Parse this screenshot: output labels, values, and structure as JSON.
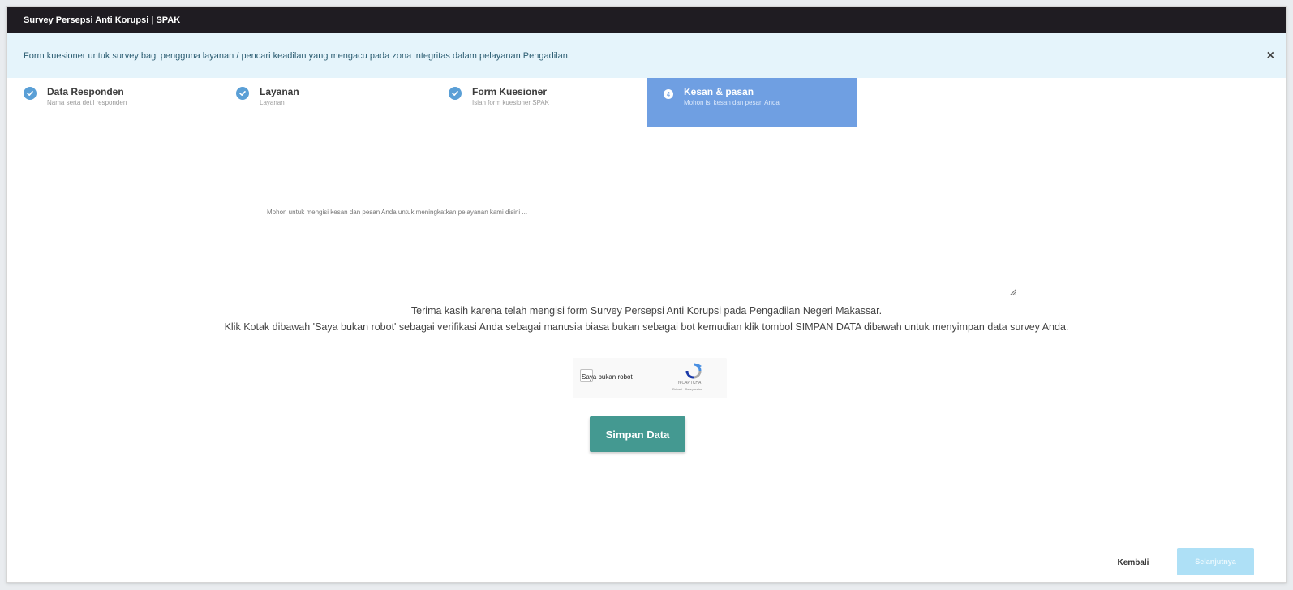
{
  "window": {
    "title": "Survey Persepsi Anti Korupsi | SPAK"
  },
  "info": {
    "text": "Form kuesioner untuk survey bagi pengguna layanan / pencari keadilan yang mengacu pada zona integritas dalam pelayanan Pengadilan.",
    "close_symbol": "×"
  },
  "steps": [
    {
      "label": "Data Responden",
      "sub": "Nama serta detil responden",
      "status": "complete",
      "icon": "check-circle-icon"
    },
    {
      "label": "Layanan",
      "sub": "Layanan",
      "status": "complete",
      "icon": "check-circle-icon"
    },
    {
      "label": "Form Kuesioner",
      "sub": "Isian form kuesioner SPAK",
      "status": "complete",
      "icon": "check-circle-icon"
    },
    {
      "number": "4",
      "label": "Kesan & pasan",
      "sub": "Mohon isi kesan dan pesan Anda",
      "status": "active"
    }
  ],
  "form": {
    "textarea_placeholder": "Mohon untuk mengisi kesan dan pesan Anda untuk meningkatkan pelayanan kami disini ...",
    "thanks_line1": "Terima kasih karena telah mengisi form Survey Persepsi Anti Korupsi pada Pengadilan Negeri Makassar.",
    "thanks_line2": "Klik Kotak dibawah 'Saya bukan robot' sebagai verifikasi Anda sebagai manusia biasa bukan sebagai bot kemudian klik tombol SIMPAN DATA dibawah untuk menyimpan data survey Anda."
  },
  "captcha": {
    "label": "Saya bukan robot",
    "brand": "reCAPTCHA",
    "terms": "Privasi - Persyaratan",
    "checked": false
  },
  "buttons": {
    "save": "Simpan Data",
    "back": "Kembali",
    "next": "Selanjutnya"
  },
  "colors": {
    "titlebar": "#1f1c22",
    "info_bg": "#e5f4fb",
    "step_complete": "#5a9fd6",
    "step_active": "#6f9fe2",
    "save_button": "#449991",
    "next_button_disabled": "#aee0f6"
  }
}
